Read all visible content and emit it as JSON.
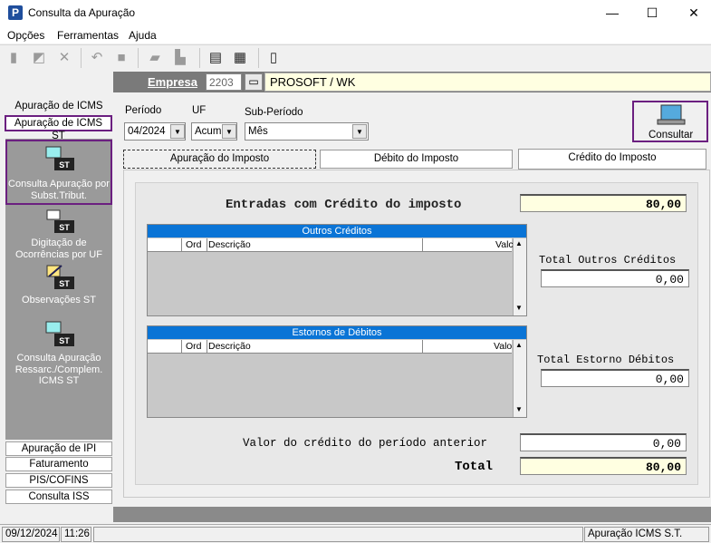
{
  "window": {
    "title": "Consulta da Apuração",
    "app_icon_letter": "P",
    "minimize": "—",
    "maximize": "☐",
    "close": "✕"
  },
  "menu": [
    "Opções",
    "Ferramentas",
    "Ajuda"
  ],
  "toolbar_icons": [
    "new-doc-icon",
    "edit-icon",
    "delete-icon",
    "undo-icon",
    "stop-icon",
    "print-icon",
    "printer2-icon",
    "report-icon",
    "calc-icon",
    "exit-icon"
  ],
  "empresa": {
    "label": "Empresa",
    "code": "2203",
    "name": "PROSOFT / WK"
  },
  "left_nav": {
    "top_items": [
      "Apuração de ICMS",
      "Apuração de ICMS ST"
    ],
    "sub_items": [
      {
        "label": "Consulta Apuração por Subst.Tribut.",
        "icon": "st-consulta-icon",
        "selected": true
      },
      {
        "label": "Digitação de Ocorrências por UF",
        "icon": "st-digitacao-icon"
      },
      {
        "label": "Observações ST",
        "icon": "st-observacoes-icon"
      },
      {
        "label": "Consulta Apuração Ressarc./Complem. ICMS ST",
        "icon": "st-ressarc-icon"
      }
    ],
    "bottom_items": [
      "Apuração de IPI",
      "Faturamento",
      "PIS/COFINS",
      "Consulta ISS"
    ]
  },
  "filters": {
    "periodo_label": "Período",
    "periodo_value": "04/2024",
    "uf_label": "UF",
    "uf_value": "Acum",
    "subperiodo_label": "Sub-Período",
    "subperiodo_value": "Mês"
  },
  "consultar_label": "Consultar",
  "tabs": [
    "Apuração do Imposto",
    "Débito do Imposto",
    "Crédito do Imposto"
  ],
  "credito": {
    "entradas_label": "Entradas com Crédito do imposto",
    "entradas_value": "80,00",
    "outros_creditos": {
      "title": "Outros Créditos",
      "columns": [
        "Ord",
        "Descrição",
        "Valc"
      ]
    },
    "total_outros_label": "Total Outros Créditos",
    "total_outros_value": "0,00",
    "estornos": {
      "title": "Estornos de Débitos",
      "columns": [
        "Ord",
        "Descrição",
        "Valo"
      ]
    },
    "total_estorno_label": "Total Estorno Débitos",
    "total_estorno_value": "0,00",
    "anterior_label": "Valor do crédito do período anterior",
    "anterior_value": "0,00",
    "total_label": "Total",
    "total_value": "80,00"
  },
  "status": {
    "date": "09/12/2024",
    "time": "11:26",
    "module": "Apuração ICMS S.T."
  },
  "colors": {
    "highlight_border": "#6b1f80",
    "grid_header": "#0a74d6",
    "yellow_field": "#ffffe1"
  }
}
